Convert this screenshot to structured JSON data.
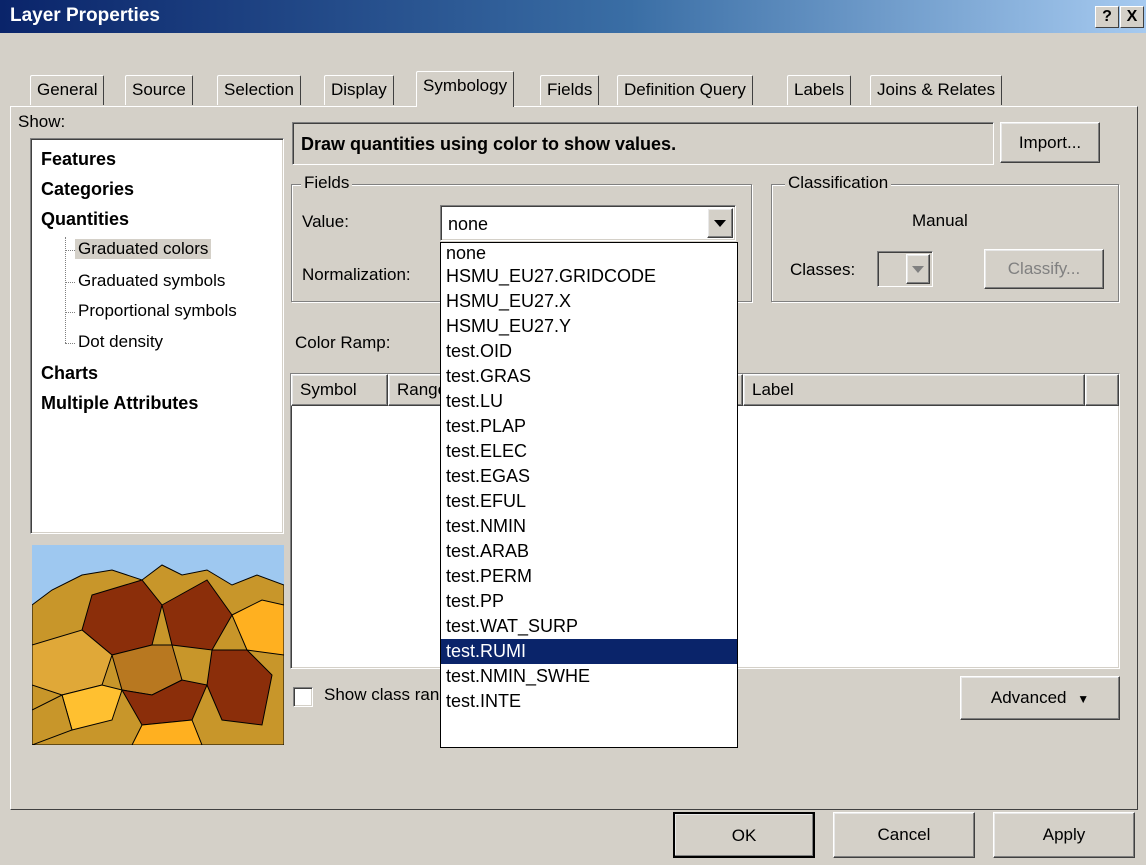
{
  "window": {
    "title": "Layer Properties",
    "help_btn": "?",
    "close_btn": "X"
  },
  "tabs": [
    "General",
    "Source",
    "Selection",
    "Display",
    "Symbology",
    "Fields",
    "Definition Query",
    "Labels",
    "Joins & Relates"
  ],
  "active_tab": "Symbology",
  "show": {
    "label": "Show:",
    "items": [
      "Features",
      "Categories",
      "Quantities",
      "Graduated colors",
      "Graduated symbols",
      "Proportional symbols",
      "Dot density",
      "Charts",
      "Multiple Attributes"
    ],
    "selected": "Graduated colors"
  },
  "description": "Draw quantities using color to show values.",
  "import_button": "Import...",
  "fields": {
    "group_label": "Fields",
    "value_label": "Value:",
    "value": "none",
    "normalization_label": "Normalization:"
  },
  "classification": {
    "group_label": "Classification",
    "method": "Manual",
    "classes_label": "Classes:",
    "classify_button": "Classify..."
  },
  "color_ramp_label": "Color Ramp:",
  "table_headers": {
    "symbol": "Symbol",
    "range": "Range",
    "label": "Label"
  },
  "show_class_checkbox": "Show class ranges using feature values",
  "advanced_button": "Advanced",
  "dropdown_options": [
    "none",
    "HSMU_EU27.GRIDCODE",
    "HSMU_EU27.X",
    "HSMU_EU27.Y",
    "test.OID",
    "test.GRAS",
    "test.LU",
    "test.PLAP",
    "test.ELEC",
    "test.EGAS",
    "test.EFUL",
    "test.NMIN",
    "test.ARAB",
    "test.PERM",
    "test.PP",
    "test.WAT_SURP",
    "test.RUMI",
    "test.NMIN_SWHE",
    "test.INTE"
  ],
  "dropdown_selected": "test.RUMI",
  "buttons": {
    "ok": "OK",
    "cancel": "Cancel",
    "apply": "Apply"
  },
  "colors": {
    "title_start": "#0a246a",
    "title_end": "#a6caf0",
    "selection": "#0a246a",
    "dialog_bg": "#d4d0c8"
  }
}
